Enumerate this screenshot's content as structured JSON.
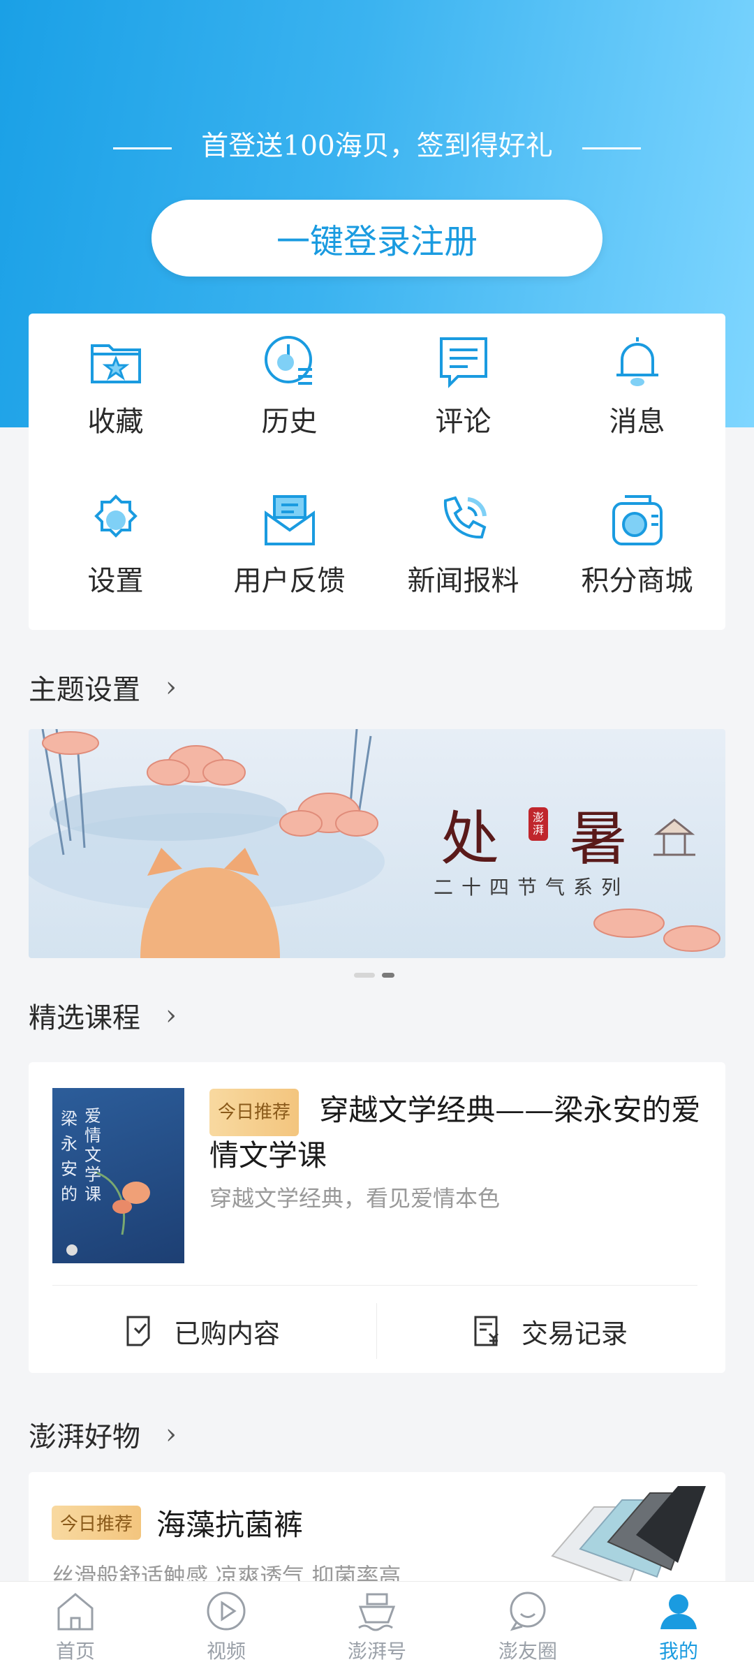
{
  "header": {
    "promo_text": "首登送100海贝，签到得好礼",
    "login_button": "一键登录注册"
  },
  "grid": {
    "items": [
      {
        "label": "收藏",
        "icon": "favorite-folder-icon"
      },
      {
        "label": "历史",
        "icon": "history-clock-icon"
      },
      {
        "label": "评论",
        "icon": "comment-icon"
      },
      {
        "label": "消息",
        "icon": "bell-icon"
      },
      {
        "label": "设置",
        "icon": "gear-icon"
      },
      {
        "label": "用户反馈",
        "icon": "feedback-envelope-icon"
      },
      {
        "label": "新闻报料",
        "icon": "phone-icon"
      },
      {
        "label": "积分商城",
        "icon": "points-store-icon"
      }
    ]
  },
  "theme": {
    "title": "主题设置",
    "banner": {
      "main_text": "处　暑",
      "seal_text": "澎湃",
      "sub_text": "二十四节气系列"
    }
  },
  "courses": {
    "title": "精选课程",
    "tag": "今日推荐",
    "course_title": "穿越文学经典——梁永安的爱情文学课",
    "course_subtitle": "穿越文学经典，看见爱情本色",
    "cover_text_a": "爱情文学课",
    "cover_text_b": "梁永安的",
    "purchased_label": "已购内容",
    "transactions_label": "交易记录"
  },
  "goods": {
    "title": "澎湃好物",
    "tag": "今日推荐",
    "product_name": "海藻抗菌裤",
    "product_desc": "丝滑般舒适触感  凉爽透气  抑菌率高"
  },
  "tabbar": {
    "items": [
      {
        "label": "首页",
        "icon": "home-icon"
      },
      {
        "label": "视频",
        "icon": "video-play-icon"
      },
      {
        "label": "澎湃号",
        "icon": "ship-icon"
      },
      {
        "label": "澎友圈",
        "icon": "chat-bubble-icon"
      },
      {
        "label": "我的",
        "icon": "user-profile-icon"
      }
    ],
    "active": "我的"
  },
  "colors": {
    "accent": "#1a9be0",
    "tag_bg": "#f3c57e"
  }
}
